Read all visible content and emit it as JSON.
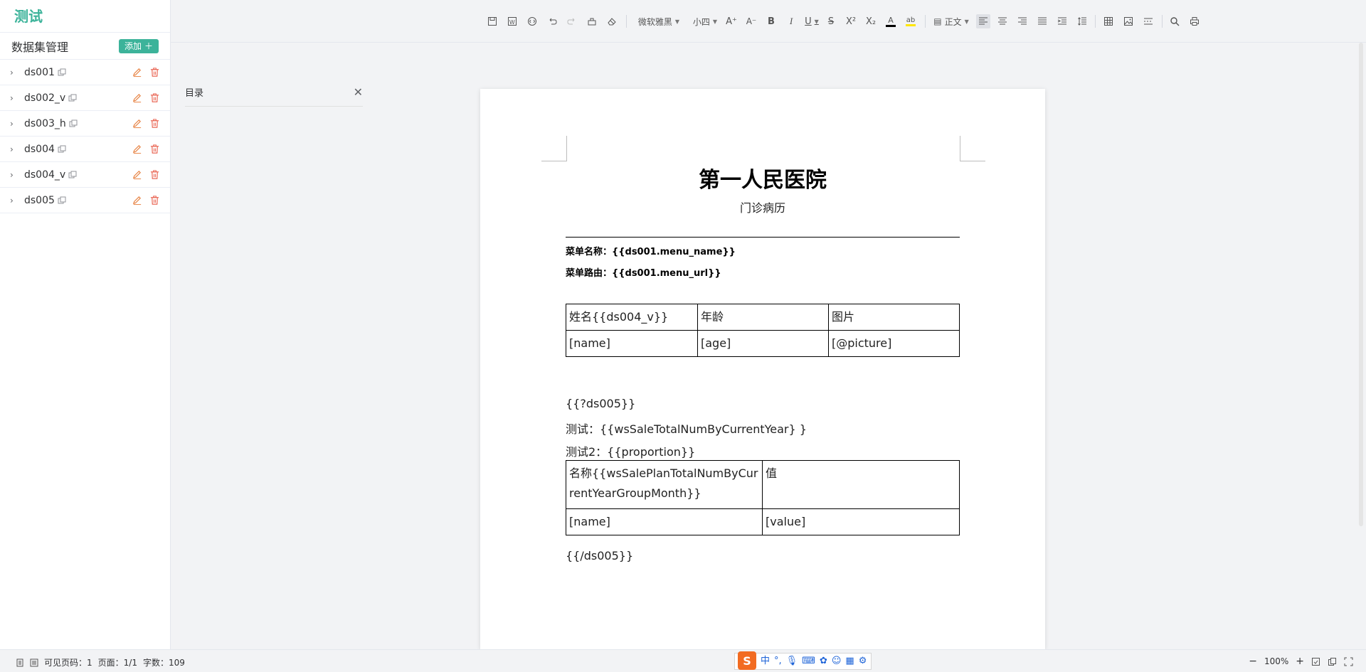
{
  "app": {
    "title": "测试"
  },
  "datasets": {
    "header_title": "数据集管理",
    "add_label": "添加",
    "items": [
      {
        "name": "ds001"
      },
      {
        "name": "ds002_v"
      },
      {
        "name": "ds003_h"
      },
      {
        "name": "ds004"
      },
      {
        "name": "ds004_v"
      },
      {
        "name": "ds005"
      }
    ]
  },
  "toolbar": {
    "font_family": "微软雅黑",
    "font_size": "小四",
    "paragraph_style": "正文",
    "icons": [
      "save-icon",
      "export-word-icon",
      "code-icon",
      "undo-icon",
      "redo-icon",
      "format-painter-icon",
      "eraser-icon",
      "font-family-select",
      "font-size-select",
      "increase-font-icon",
      "decrease-font-icon",
      "bold-icon",
      "italic-icon",
      "underline-icon",
      "strikethrough-icon",
      "superscript-icon",
      "subscript-icon",
      "font-color-icon",
      "highlight-icon",
      "paragraph-style-select",
      "align-left-icon",
      "align-center-icon",
      "align-right-icon",
      "justify-icon",
      "indent-icon",
      "line-spacing-icon",
      "table-icon",
      "image-icon",
      "separator-icon",
      "search-icon",
      "print-icon"
    ]
  },
  "catalog": {
    "title": "目录"
  },
  "document": {
    "title": "第一人民医院",
    "subtitle": "门诊病历",
    "menu_name_line": "菜单名称：{{ds001.menu_name}}",
    "menu_url_line": "菜单路由：{{ds001.menu_url}}",
    "table1": {
      "header": [
        "姓名{{ds004_v}}",
        "年龄",
        "图片"
      ],
      "row": [
        "[name]",
        "[age]",
        "[@picture]"
      ]
    },
    "ds005_open": "{{?ds005}}",
    "test_line": "测试：{{wsSaleTotalNumByCurrentYear} }",
    "test2_line": "测试2：{{proportion}}",
    "table2": {
      "header": [
        "名称{{wsSalePlanTotalNumByCurrentYearGroupMonth}}",
        "值"
      ],
      "row": [
        "[name]",
        "[value]"
      ]
    },
    "ds005_close": "{{/ds005}}"
  },
  "status": {
    "visible_pages": "可见页码：1",
    "page": "页面：1/1",
    "word_count": "字数：109",
    "zoom": "100%"
  },
  "ime": {
    "mode": "中"
  },
  "colors": {
    "accent": "#3cb39a",
    "danger": "#f56c6c",
    "edit": "#e6a23c"
  }
}
